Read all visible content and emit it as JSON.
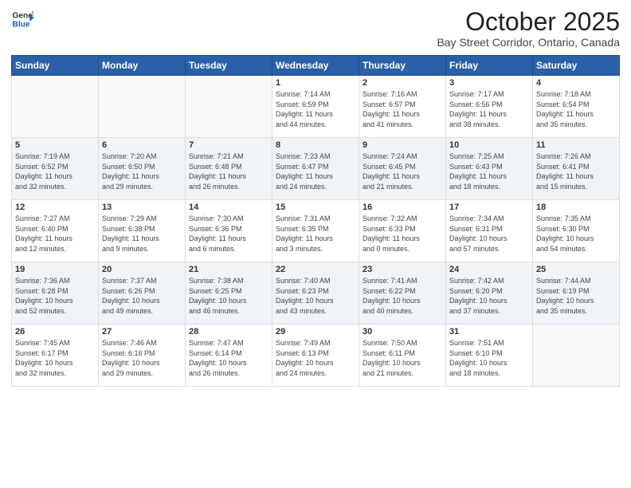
{
  "header": {
    "logo_line1": "General",
    "logo_line2": "Blue",
    "month": "October 2025",
    "location": "Bay Street Corridor, Ontario, Canada"
  },
  "weekdays": [
    "Sunday",
    "Monday",
    "Tuesday",
    "Wednesday",
    "Thursday",
    "Friday",
    "Saturday"
  ],
  "weeks": [
    [
      {
        "day": "",
        "info": ""
      },
      {
        "day": "",
        "info": ""
      },
      {
        "day": "",
        "info": ""
      },
      {
        "day": "1",
        "info": "Sunrise: 7:14 AM\nSunset: 6:59 PM\nDaylight: 11 hours\nand 44 minutes."
      },
      {
        "day": "2",
        "info": "Sunrise: 7:16 AM\nSunset: 6:57 PM\nDaylight: 11 hours\nand 41 minutes."
      },
      {
        "day": "3",
        "info": "Sunrise: 7:17 AM\nSunset: 6:56 PM\nDaylight: 11 hours\nand 38 minutes."
      },
      {
        "day": "4",
        "info": "Sunrise: 7:18 AM\nSunset: 6:54 PM\nDaylight: 11 hours\nand 35 minutes."
      }
    ],
    [
      {
        "day": "5",
        "info": "Sunrise: 7:19 AM\nSunset: 6:52 PM\nDaylight: 11 hours\nand 32 minutes."
      },
      {
        "day": "6",
        "info": "Sunrise: 7:20 AM\nSunset: 6:50 PM\nDaylight: 11 hours\nand 29 minutes."
      },
      {
        "day": "7",
        "info": "Sunrise: 7:21 AM\nSunset: 6:48 PM\nDaylight: 11 hours\nand 26 minutes."
      },
      {
        "day": "8",
        "info": "Sunrise: 7:23 AM\nSunset: 6:47 PM\nDaylight: 11 hours\nand 24 minutes."
      },
      {
        "day": "9",
        "info": "Sunrise: 7:24 AM\nSunset: 6:45 PM\nDaylight: 11 hours\nand 21 minutes."
      },
      {
        "day": "10",
        "info": "Sunrise: 7:25 AM\nSunset: 6:43 PM\nDaylight: 11 hours\nand 18 minutes."
      },
      {
        "day": "11",
        "info": "Sunrise: 7:26 AM\nSunset: 6:41 PM\nDaylight: 11 hours\nand 15 minutes."
      }
    ],
    [
      {
        "day": "12",
        "info": "Sunrise: 7:27 AM\nSunset: 6:40 PM\nDaylight: 11 hours\nand 12 minutes."
      },
      {
        "day": "13",
        "info": "Sunrise: 7:29 AM\nSunset: 6:38 PM\nDaylight: 11 hours\nand 9 minutes."
      },
      {
        "day": "14",
        "info": "Sunrise: 7:30 AM\nSunset: 6:36 PM\nDaylight: 11 hours\nand 6 minutes."
      },
      {
        "day": "15",
        "info": "Sunrise: 7:31 AM\nSunset: 6:35 PM\nDaylight: 11 hours\nand 3 minutes."
      },
      {
        "day": "16",
        "info": "Sunrise: 7:32 AM\nSunset: 6:33 PM\nDaylight: 11 hours\nand 0 minutes."
      },
      {
        "day": "17",
        "info": "Sunrise: 7:34 AM\nSunset: 6:31 PM\nDaylight: 10 hours\nand 57 minutes."
      },
      {
        "day": "18",
        "info": "Sunrise: 7:35 AM\nSunset: 6:30 PM\nDaylight: 10 hours\nand 54 minutes."
      }
    ],
    [
      {
        "day": "19",
        "info": "Sunrise: 7:36 AM\nSunset: 6:28 PM\nDaylight: 10 hours\nand 52 minutes."
      },
      {
        "day": "20",
        "info": "Sunrise: 7:37 AM\nSunset: 6:26 PM\nDaylight: 10 hours\nand 49 minutes."
      },
      {
        "day": "21",
        "info": "Sunrise: 7:38 AM\nSunset: 6:25 PM\nDaylight: 10 hours\nand 46 minutes."
      },
      {
        "day": "22",
        "info": "Sunrise: 7:40 AM\nSunset: 6:23 PM\nDaylight: 10 hours\nand 43 minutes."
      },
      {
        "day": "23",
        "info": "Sunrise: 7:41 AM\nSunset: 6:22 PM\nDaylight: 10 hours\nand 40 minutes."
      },
      {
        "day": "24",
        "info": "Sunrise: 7:42 AM\nSunset: 6:20 PM\nDaylight: 10 hours\nand 37 minutes."
      },
      {
        "day": "25",
        "info": "Sunrise: 7:44 AM\nSunset: 6:19 PM\nDaylight: 10 hours\nand 35 minutes."
      }
    ],
    [
      {
        "day": "26",
        "info": "Sunrise: 7:45 AM\nSunset: 6:17 PM\nDaylight: 10 hours\nand 32 minutes."
      },
      {
        "day": "27",
        "info": "Sunrise: 7:46 AM\nSunset: 6:16 PM\nDaylight: 10 hours\nand 29 minutes."
      },
      {
        "day": "28",
        "info": "Sunrise: 7:47 AM\nSunset: 6:14 PM\nDaylight: 10 hours\nand 26 minutes."
      },
      {
        "day": "29",
        "info": "Sunrise: 7:49 AM\nSunset: 6:13 PM\nDaylight: 10 hours\nand 24 minutes."
      },
      {
        "day": "30",
        "info": "Sunrise: 7:50 AM\nSunset: 6:11 PM\nDaylight: 10 hours\nand 21 minutes."
      },
      {
        "day": "31",
        "info": "Sunrise: 7:51 AM\nSunset: 6:10 PM\nDaylight: 10 hours\nand 18 minutes."
      },
      {
        "day": "",
        "info": ""
      }
    ]
  ]
}
